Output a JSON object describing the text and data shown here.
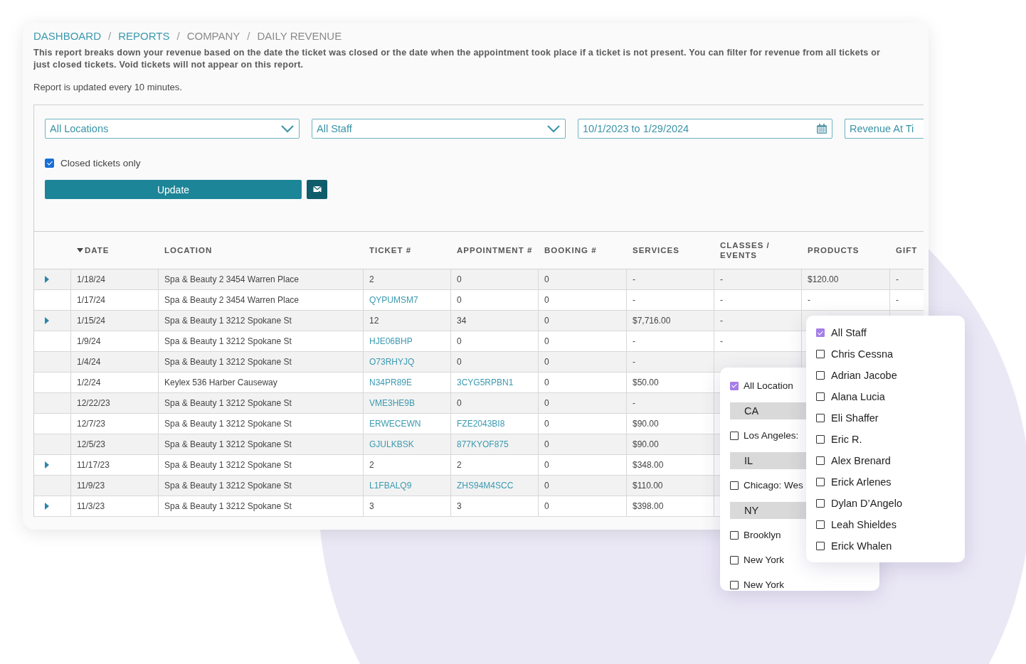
{
  "breadcrumb": [
    {
      "label": "DASHBOARD",
      "link": true,
      "separator": "/"
    },
    {
      "label": "REPORTS",
      "link": true,
      "separator": "/"
    },
    {
      "label": "COMPANY",
      "link": false,
      "separator": "/"
    },
    {
      "label": "DAILY REVENUE",
      "link": false
    }
  ],
  "description": "This report breaks down your revenue based on the date the ticket was closed or the date when the appointment took place if a ticket is not present. You can filter for revenue from all tickets or\njust closed tickets. Void tickets will not appear on this report.",
  "update_note": "Report is updated every 10 minutes.",
  "filters": {
    "location": "All Locations",
    "staff": "All Staff",
    "date_range": "10/1/2023 to 1/29/2024",
    "revenue_type": "Revenue At Ti",
    "closed_only": {
      "label": "Closed tickets only",
      "checked": true
    },
    "update_button": "Update"
  },
  "table": {
    "columns": [
      {
        "label": "DATE",
        "sorted": true
      },
      {
        "label": "LOCATION",
        "sorted": false
      },
      {
        "label": "TICKET #",
        "sorted": false
      },
      {
        "label": "APPOINTMENT #",
        "sorted": false
      },
      {
        "label": "BOOKING #",
        "sorted": false
      },
      {
        "label": "SERVICES",
        "sorted": false
      },
      {
        "label": "CLASSES / EVENTS",
        "sorted": false
      },
      {
        "label": "PRODUCTS",
        "sorted": false
      },
      {
        "label": "GIFT",
        "sorted": false
      }
    ],
    "rows": [
      {
        "expandable": true,
        "date": "1/18/24",
        "location": "Spa & Beauty 2 3454 Warren Place",
        "ticket": "2",
        "ticket_link": false,
        "appointment": "0",
        "appointment_link": false,
        "booking": "0",
        "services": "-",
        "classes": "-",
        "products": "$120.00",
        "gift": "-"
      },
      {
        "expandable": false,
        "date": "1/17/24",
        "location": "Spa & Beauty 2 3454 Warren Place",
        "ticket": "QYPUMSM7",
        "ticket_link": true,
        "appointment": "0",
        "appointment_link": false,
        "booking": "0",
        "services": "-",
        "classes": "-",
        "products": "-",
        "gift": "-"
      },
      {
        "expandable": true,
        "date": "1/15/24",
        "location": "Spa & Beauty 1 3212 Spokane St",
        "ticket": "12",
        "ticket_link": false,
        "appointment": "34",
        "appointment_link": false,
        "booking": "0",
        "services": "$7,716.00",
        "classes": "-"
      },
      {
        "expandable": false,
        "date": "1/9/24",
        "location": "Spa & Beauty 1 3212 Spokane St",
        "ticket": "HJE06BHP",
        "ticket_link": true,
        "appointment": "0",
        "appointment_link": false,
        "booking": "0",
        "services": "-",
        "classes": "-"
      },
      {
        "expandable": false,
        "date": "1/4/24",
        "location": "Spa & Beauty 1 3212 Spokane St",
        "ticket": "O73RHYJQ",
        "ticket_link": true,
        "appointment": "0",
        "appointment_link": false,
        "booking": "0",
        "services": "-"
      },
      {
        "expandable": false,
        "date": "1/2/24",
        "location": "Keylex 536 Harber Causeway",
        "ticket": "N34PR89E",
        "ticket_link": true,
        "appointment": "3CYG5RPBN1",
        "appointment_link": true,
        "booking": "0",
        "services": "$50.00"
      },
      {
        "expandable": false,
        "date": "12/22/23",
        "location": "Spa & Beauty 1 3212 Spokane St",
        "ticket": "VME3HE9B",
        "ticket_link": true,
        "appointment": "0",
        "appointment_link": false,
        "booking": "0",
        "services": "-"
      },
      {
        "expandable": false,
        "date": "12/7/23",
        "location": "Spa & Beauty 1 3212 Spokane St",
        "ticket": "ERWECEWN",
        "ticket_link": true,
        "appointment": "FZE2043BI8",
        "appointment_link": true,
        "booking": "0",
        "services": "$90.00"
      },
      {
        "expandable": false,
        "date": "12/5/23",
        "location": "Spa & Beauty 1 3212 Spokane St",
        "ticket": "GJULKBSK",
        "ticket_link": true,
        "appointment": "877KYOF875",
        "appointment_link": true,
        "booking": "0",
        "services": "$90.00"
      },
      {
        "expandable": true,
        "date": "11/17/23",
        "location": "Spa & Beauty 1 3212 Spokane St",
        "ticket": "2",
        "ticket_link": false,
        "appointment": "2",
        "appointment_link": false,
        "booking": "0",
        "services": "$348.00"
      },
      {
        "expandable": false,
        "date": "11/9/23",
        "location": "Spa & Beauty 1 3212 Spokane St",
        "ticket": "L1FBALQ9",
        "ticket_link": true,
        "appointment": "ZHS94M4SCC",
        "appointment_link": true,
        "booking": "0",
        "services": "$110.00"
      },
      {
        "expandable": true,
        "date": "11/3/23",
        "location": "Spa & Beauty 1 3212 Spokane St",
        "ticket": "3",
        "ticket_link": false,
        "appointment": "3",
        "appointment_link": false,
        "booking": "0",
        "services": "$398.00"
      }
    ]
  },
  "location_menu": {
    "items": [
      {
        "kind": "option",
        "label": "All Location",
        "checked": true
      },
      {
        "kind": "group",
        "label": "CA"
      },
      {
        "kind": "option",
        "label": "Los Angeles:",
        "checked": false
      },
      {
        "kind": "group",
        "label": "IL"
      },
      {
        "kind": "option",
        "label": "Chicago: Wes",
        "checked": false
      },
      {
        "kind": "group",
        "label": "NY"
      },
      {
        "kind": "option",
        "label": "Brooklyn",
        "checked": false
      },
      {
        "kind": "option",
        "label": "New York",
        "checked": false
      },
      {
        "kind": "option",
        "label": "New York",
        "checked": false
      }
    ]
  },
  "staff_menu": {
    "items": [
      {
        "label": "All Staff",
        "checked": true
      },
      {
        "label": "Chris Cessna",
        "checked": false
      },
      {
        "label": "Adrian Jacobe",
        "checked": false
      },
      {
        "label": "Alana Lucia",
        "checked": false
      },
      {
        "label": "Eli Shaffer",
        "checked": false
      },
      {
        "label": "Eric R.",
        "checked": false
      },
      {
        "label": "Alex Brenard",
        "checked": false
      },
      {
        "label": "Erick Arlenes",
        "checked": false
      },
      {
        "label": "Dylan D’Angelo",
        "checked": false
      },
      {
        "label": "Leah Shieldes",
        "checked": false
      },
      {
        "label": "Erick Whalen",
        "checked": false
      }
    ]
  }
}
